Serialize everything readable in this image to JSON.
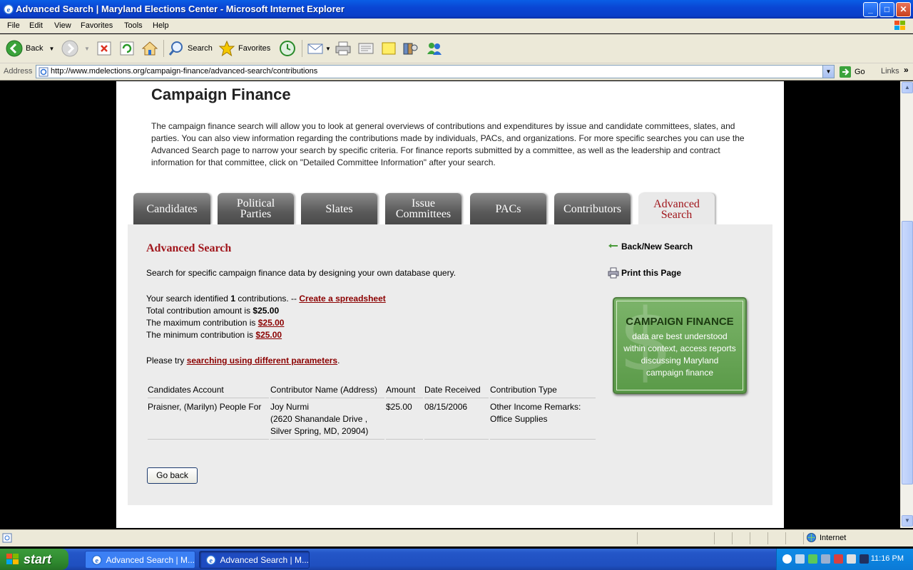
{
  "window": {
    "title": "Advanced Search | Maryland Elections Center - Microsoft Internet Explorer",
    "controls": {
      "minimize": "_",
      "maximize": "□",
      "close": "✕"
    }
  },
  "menu": [
    "File",
    "Edit",
    "View",
    "Favorites",
    "Tools",
    "Help"
  ],
  "toolbar": {
    "back_label": "Back",
    "search_label": "Search",
    "favorites_label": "Favorites",
    "icons": [
      "back-icon",
      "forward-icon",
      "stop-icon",
      "refresh-icon",
      "home-icon",
      "search-icon",
      "favorites-icon",
      "history-icon",
      "mail-icon",
      "print-icon",
      "edit-icon",
      "discuss-icon",
      "research-icon",
      "messenger-icon"
    ]
  },
  "address": {
    "label": "Address",
    "url": "http://www.mdelections.org/campaign-finance/advanced-search/contributions",
    "go_label": "Go",
    "links_label": "Links"
  },
  "page": {
    "title": "Campaign Finance",
    "intro": "The campaign finance search will allow you to look at general overviews of contributions and expenditures by issue and candidate committees, slates, and parties. You can also view information regarding the contributions made by individuals, PACs, and organizations. For more specific searches you can use the Advanced Search page to narrow your search by specific criteria. For finance reports submitted by a committee, as well as the leadership and contract information for that committee, click on \"Detailed Committee Information\" after your search.",
    "tabs": [
      {
        "label": "Candidates",
        "active": false
      },
      {
        "label": "Political Parties",
        "active": false
      },
      {
        "label": "Slates",
        "active": false
      },
      {
        "label": "Issue Committees",
        "active": false
      },
      {
        "label": "PACs",
        "active": false
      },
      {
        "label": "Contributors",
        "active": false
      },
      {
        "label": "Advanced Search",
        "active": true
      }
    ],
    "section_title": "Advanced Search",
    "description": "Search for specific campaign finance data by designing your own database query.",
    "summary": {
      "identified_prefix": "Your search identified ",
      "identified_count": "1",
      "identified_suffix": " contributions. -- ",
      "spreadsheet_link": "Create a spreadsheet",
      "total_prefix": "Total contribution amount is ",
      "total_value": "$25.00",
      "max_prefix": "The maximum contribution is ",
      "max_value": "$25.00",
      "min_prefix": "The minimum contribution is ",
      "min_value": "$25.00",
      "retry_prefix": "Please try ",
      "retry_link": "searching using different parameters",
      "retry_suffix": "."
    },
    "side_links": {
      "back_new_search": "Back/New Search",
      "print_page": "Print this Page"
    },
    "promo": {
      "dollar_glyph": "$",
      "headline": "CAMPAIGN FINANCE",
      "body": "data are best understood within context, access reports discussing Maryland campaign finance"
    },
    "table": {
      "headers": [
        "Candidates Account",
        "Contributor Name (Address)",
        "Amount",
        "Date Received",
        "Contribution Type"
      ],
      "rows": [
        {
          "account": "Praisner, (Marilyn) People For",
          "contributor": "Joy Nurmi",
          "address": "(2620 Shanandale Drive , Silver Spring, MD, 20904)",
          "amount": "$25.00",
          "date": "08/15/2006",
          "type": "Other Income Remarks: Office Supplies"
        }
      ]
    },
    "go_back_label": "Go back"
  },
  "statusbar": {
    "zone": "Internet"
  },
  "taskbar": {
    "start_label": "start",
    "buttons": [
      "Advanced Search | M...",
      "Advanced Search | M..."
    ],
    "clock": "11:16 PM"
  },
  "colors": {
    "accent_red": "#a0151b",
    "tab_gray": "#5a5a5a",
    "promo_green": "#6aa858",
    "xp_blue": "#0a46d4"
  }
}
